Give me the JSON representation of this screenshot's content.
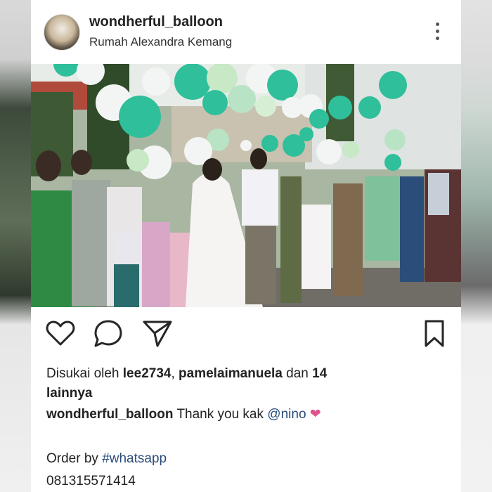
{
  "post": {
    "username": "wondherful_balloon",
    "location": "Rumah Alexandra Kemang",
    "more_icon": "more-vertical-icon",
    "image_alt_icon": "photo"
  },
  "actions": {
    "like_icon": "heart-icon",
    "comment_icon": "comment-icon",
    "share_icon": "send-icon",
    "save_icon": "bookmark-icon"
  },
  "likes": {
    "prefix": "Disukai oleh",
    "user1": "lee2734",
    "sep": ",",
    "user2": "pamelaimanuela",
    "mid": "dan",
    "count": "14",
    "suffix": "lainnya"
  },
  "caption": {
    "username": "wondherful_balloon",
    "text": "Thank you kak",
    "mention": "@nino",
    "emoji": "❤"
  },
  "order": {
    "text": "Order by",
    "hashtag": "#whatsapp",
    "phone": "081315571414"
  },
  "colors": {
    "mention": "#2a4d7a",
    "heart": "#e0558c",
    "balloon_teal": "#2fbf9a",
    "balloon_white": "#f3f5f5"
  }
}
